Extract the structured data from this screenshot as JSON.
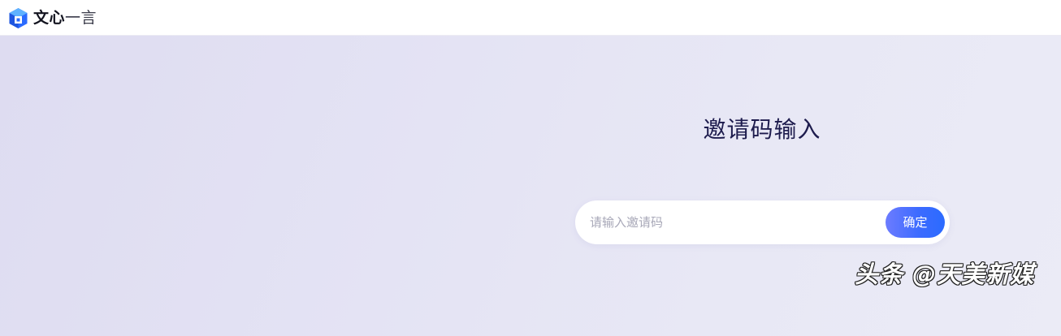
{
  "header": {
    "brand_name_strong": "文心",
    "brand_name_light": "一言",
    "logo_icon": "wenxin-cube-logo-icon"
  },
  "main": {
    "title": "邀请码输入",
    "invite_input": {
      "placeholder": "请输入邀请码",
      "value": ""
    },
    "confirm_label": "确定"
  },
  "watermark": {
    "text": "头条 @天美新媒"
  },
  "colors": {
    "accent": "#3d6bff",
    "title": "#1d1b4d",
    "background": "#e4e3f4",
    "logo": "#2b6bff"
  }
}
